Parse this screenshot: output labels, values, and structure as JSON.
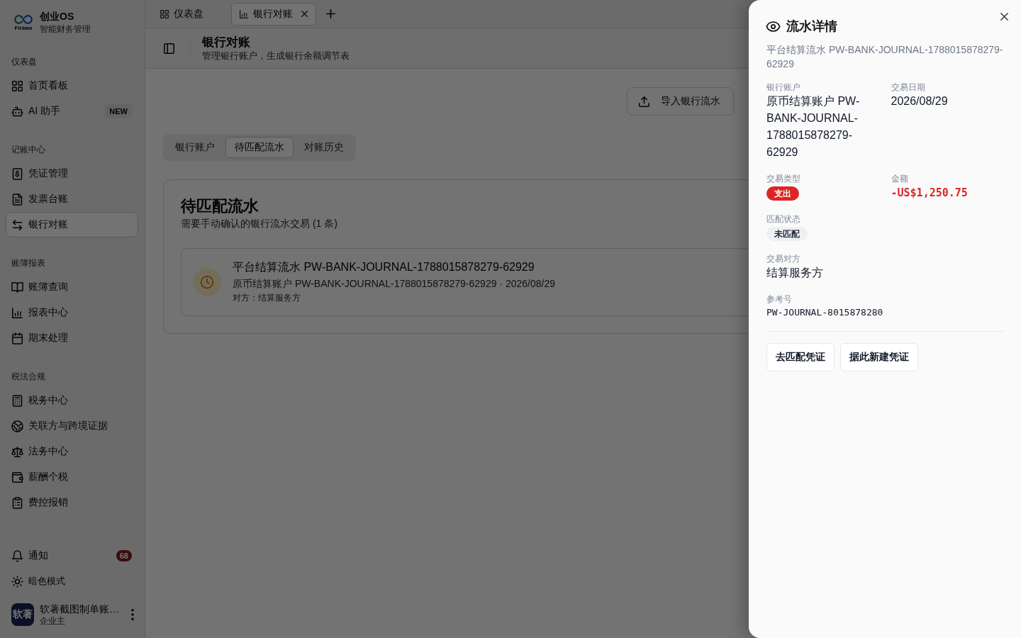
{
  "sidebar": {
    "brand": {
      "logo_text": "Finlaw",
      "name": "创业OS",
      "tagline": "智能财务管理"
    },
    "sections": [
      {
        "title": "仪表盘",
        "items": [
          {
            "label": "首页看板",
            "selected": false
          },
          {
            "label": "AI 助手",
            "badge": "NEW",
            "selected": false
          }
        ]
      },
      {
        "title": "记账中心",
        "items": [
          {
            "label": "凭证管理",
            "selected": false
          },
          {
            "label": "发票台账",
            "selected": false
          },
          {
            "label": "银行对账",
            "selected": true
          }
        ]
      },
      {
        "title": "账簿报表",
        "items": [
          {
            "label": "账簿查询",
            "selected": false
          },
          {
            "label": "报表中心",
            "selected": false
          },
          {
            "label": "期末处理",
            "selected": false
          }
        ]
      },
      {
        "title": "税法合规",
        "items": [
          {
            "label": "税务中心",
            "selected": false
          },
          {
            "label": "关联方与跨境证据",
            "selected": false
          },
          {
            "label": "法务中心",
            "selected": false
          },
          {
            "label": "薪酬个税",
            "selected": false
          },
          {
            "label": "费控报销",
            "selected": false
          }
        ]
      }
    ],
    "footer": {
      "items": [
        {
          "label": "通知",
          "badge": "68"
        },
        {
          "label": "暗色模式"
        }
      ],
      "user": {
        "avatar_text": "软著",
        "name": "软著截图制单账…",
        "role": "企业主"
      }
    }
  },
  "tabs": [
    {
      "label": "仪表盘",
      "selected": false,
      "closable": false
    },
    {
      "label": "银行对账",
      "selected": true,
      "closable": true
    }
  ],
  "header": {
    "title": "银行对账",
    "subtitle": "管理银行账户，生成银行余额调节表"
  },
  "actions": [
    {
      "label": "导入银行流水"
    }
  ],
  "views": [
    {
      "label": "银行账户",
      "selected": false
    },
    {
      "label": "待匹配流水",
      "selected": true
    },
    {
      "label": "对账历史",
      "selected": false
    }
  ],
  "panel": {
    "title": "待匹配流水",
    "subtitle": "需要手动确认的银行流水交易 (1 条)",
    "transactions": [
      {
        "title": "平台结算流水 PW-BANK-JOURNAL-1788015878279-62929",
        "meta": "原币结算账户 PW-BANK-JOURNAL-1788015878279-62929 · 2026/08/29",
        "counterparty": "对方：结算服务方"
      }
    ]
  },
  "drawer": {
    "title": "流水详情",
    "subtitle": "平台结算流水 PW-BANK-JOURNAL-1788015878279-62929",
    "rows": [
      [
        {
          "label": "银行账户",
          "value": "原币结算账户 PW-BANK-JOURNAL-1788015878279-62929",
          "kind": "text"
        },
        {
          "label": "交易日期",
          "value": "2026/08/29",
          "kind": "text"
        }
      ],
      [
        {
          "label": "交易类型",
          "value": "支出",
          "kind": "badge",
          "color": "#dc2626"
        },
        {
          "label": "金额",
          "value": "-US$1,250.75",
          "kind": "amount"
        }
      ],
      [
        {
          "label": "匹配状态",
          "value": "未匹配",
          "kind": "badge",
          "color": "#eef0f3"
        }
      ],
      [
        {
          "label": "交易对方",
          "value": "结算服务方",
          "kind": "text"
        }
      ],
      [
        {
          "label": "参考号",
          "value": "PW-JOURNAL-8015878280",
          "kind": "mono"
        }
      ]
    ],
    "buttons": [
      {
        "label": "去匹配凭证"
      },
      {
        "label": "据此新建凭证"
      }
    ]
  }
}
